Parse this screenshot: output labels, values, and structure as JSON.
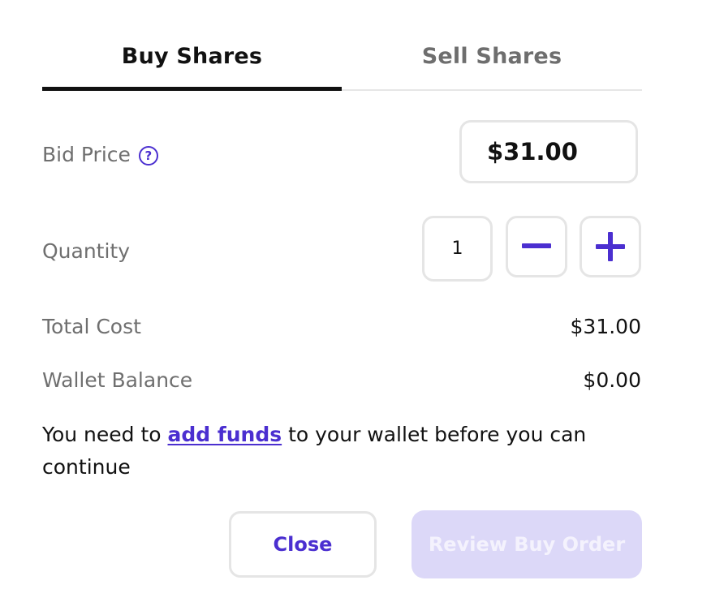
{
  "tabs": {
    "buy_label": "Buy Shares",
    "sell_label": "Sell Shares"
  },
  "bid_price": {
    "label": "Bid Price",
    "help_icon": "question-circle-icon",
    "value": "$31.00"
  },
  "quantity": {
    "label": "Quantity",
    "value": "1",
    "decrement_icon": "minus-icon",
    "increment_icon": "plus-icon"
  },
  "total_cost": {
    "label": "Total Cost",
    "value": "$31.00"
  },
  "wallet_balance": {
    "label": "Wallet Balance",
    "value": "$0.00"
  },
  "notice": {
    "before": "You need to ",
    "link": "add funds",
    "after": " to your wallet before you can continue"
  },
  "actions": {
    "close_label": "Close",
    "review_label": "Review Buy Order"
  },
  "colors": {
    "accent": "#4b2fd0",
    "disabled_button": "#dcd8f8",
    "border": "#e5e5e5",
    "muted_text": "#6f6f6f"
  }
}
